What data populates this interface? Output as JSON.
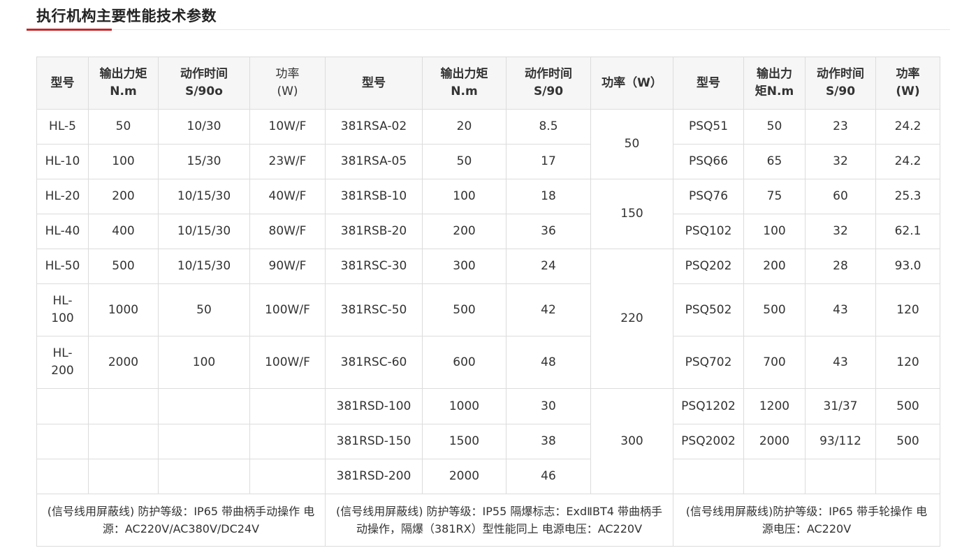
{
  "section": {
    "title": "执行机构主要性能技术参数"
  },
  "headers": {
    "hl": [
      "型号",
      "输出力矩\nN.m",
      "动作时间\nS/90o",
      "功率\n(W)"
    ],
    "rs": [
      "型号",
      "输出力矩\nN.m",
      "动作时间\nS/90",
      "功率（W）"
    ],
    "psq": [
      "型号",
      "输出力\n矩N.m",
      "动作时间\nS/90",
      "功率\n(W)"
    ]
  },
  "hl_rows": [
    [
      "HL-5",
      "50",
      "10/30",
      "10W/F"
    ],
    [
      "HL-10",
      "100",
      "15/30",
      "23W/F"
    ],
    [
      "HL-20",
      "200",
      "10/15/30",
      "40W/F"
    ],
    [
      "HL-40",
      "400",
      "10/15/30",
      "80W/F"
    ],
    [
      "HL-50",
      "500",
      "10/15/30",
      "90W/F"
    ],
    [
      "HL-\n100",
      "1000",
      "50",
      "100W/F"
    ],
    [
      "HL-\n200",
      "2000",
      "100",
      "100W/F"
    ]
  ],
  "rs_rows": [
    [
      "381RSA-02",
      "20",
      "8.5"
    ],
    [
      "381RSA-05",
      "50",
      "17"
    ],
    [
      "381RSB-10",
      "100",
      "18"
    ],
    [
      "381RSB-20",
      "200",
      "36"
    ],
    [
      "381RSC-30",
      "300",
      "24"
    ],
    [
      "381RSC-50",
      "500",
      "42"
    ],
    [
      "381RSC-60",
      "600",
      "48"
    ],
    [
      "381RSD-100",
      "1000",
      "30"
    ],
    [
      "381RSD-150",
      "1500",
      "38"
    ],
    [
      "381RSD-200",
      "2000",
      "46"
    ]
  ],
  "rs_power": [
    "50",
    "150",
    "220",
    "300"
  ],
  "psq_rows": [
    [
      "PSQ51",
      "50",
      "23",
      "24.2"
    ],
    [
      "PSQ66",
      "65",
      "32",
      "24.2"
    ],
    [
      "PSQ76",
      "75",
      "60",
      "25.3"
    ],
    [
      "PSQ102",
      "100",
      "32",
      "62.1"
    ],
    [
      "PSQ202",
      "200",
      "28",
      "93.0"
    ],
    [
      "PSQ502",
      "500",
      "43",
      "120"
    ],
    [
      "PSQ702",
      "700",
      "43",
      "120"
    ],
    [
      "PSQ1202",
      "1200",
      "31/37",
      "500"
    ],
    [
      "PSQ2002",
      "2000",
      "93/112",
      "500"
    ]
  ],
  "notes": {
    "hl": "(信号线用屏蔽线) 防护等级：IP65 带曲柄手动操作 电源：AC220V/AC380V/DC24V",
    "rs": "(信号线用屏蔽线) 防护等级：IP55 隔爆标志：ExdⅡBT4 带曲柄手动操作，隔爆（381RX）型性能同上 电源电压：AC220V",
    "psq": "(信号线用屏蔽线)防护等级：IP65 带手轮操作 电源电压：AC220V"
  }
}
